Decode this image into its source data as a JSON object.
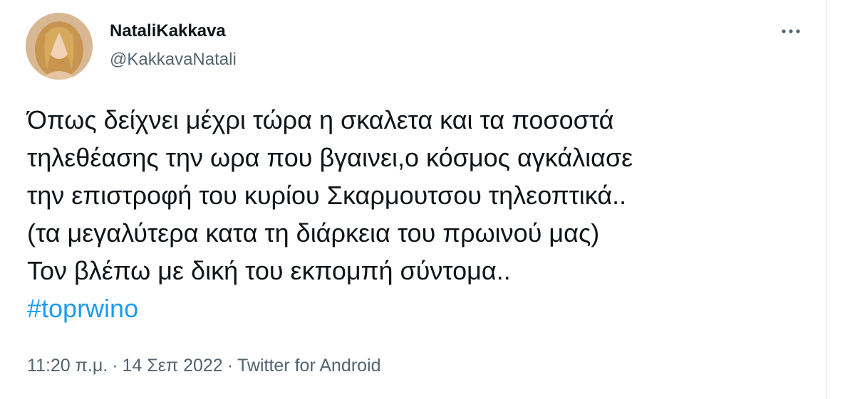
{
  "author": {
    "display_name": "NataliKakkava",
    "handle": "@KakkavaNatali",
    "avatar_icon": "profile-photo"
  },
  "more_icon": "more-dots-icon",
  "tweet": {
    "lines": [
      "Όπως δείχνει μέχρι τώρα η σκαλετα και τα ποσοστά",
      "τηλεθέασης την ωρα που βγαινει,ο κόσμος αγκάλιασε",
      "την επιστροφή του κυρίου Σκαρμουτσου τηλεοπτικά..",
      "(τα μεγαλύτερα κατα τη διάρκεια του πρωινού μας)",
      "Τον βλέπω με δική του εκπομπή σύντομα.."
    ],
    "hashtag": "#toprwino"
  },
  "meta": {
    "time": "11:20 π.μ.",
    "separator": "·",
    "date": "14 Σεπ 2022",
    "source": "Twitter for Android"
  },
  "colors": {
    "text": "#0f1419",
    "secondary": "#536471",
    "link": "#1d9bf0"
  }
}
